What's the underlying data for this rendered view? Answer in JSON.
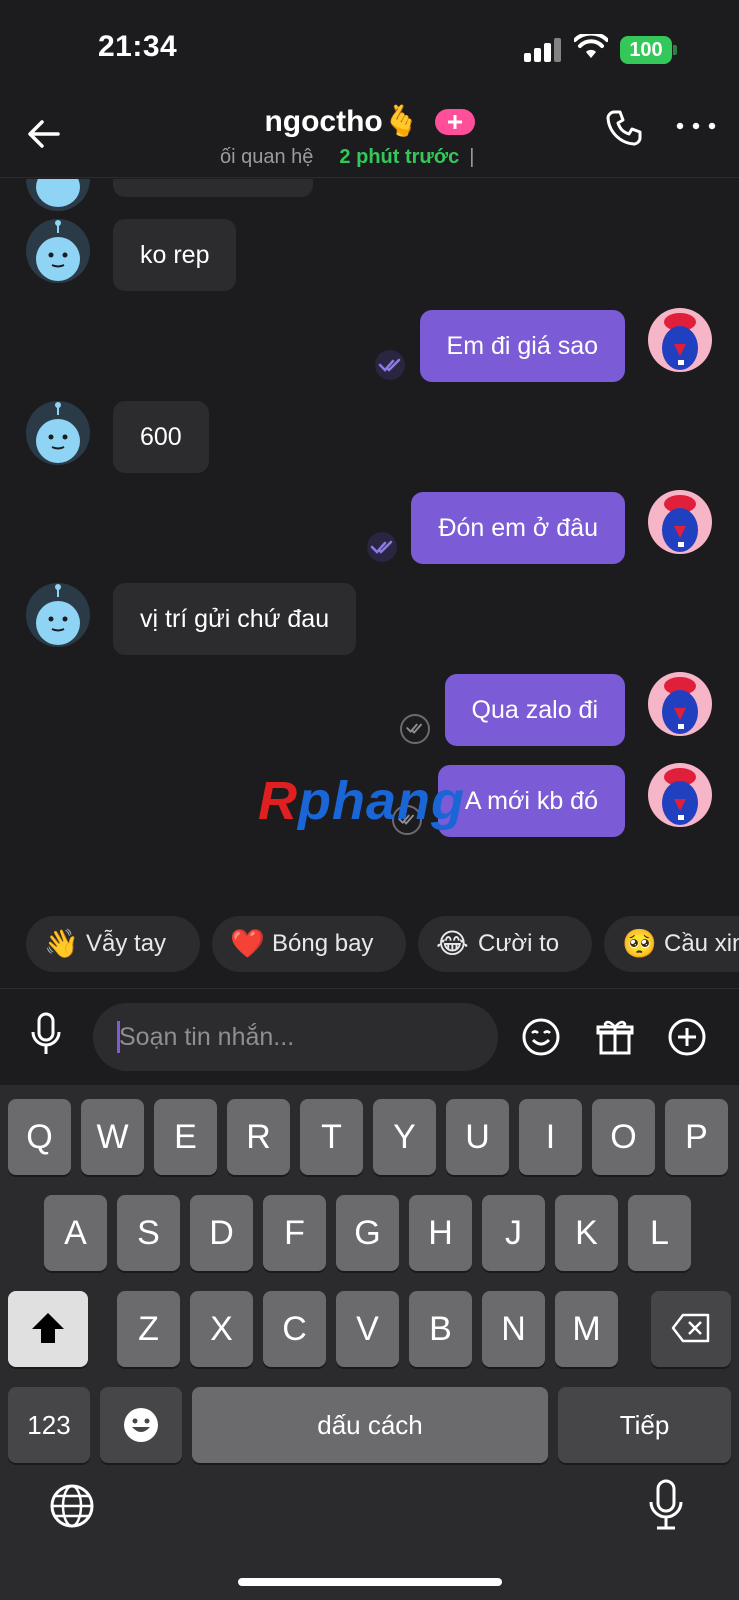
{
  "status_bar": {
    "time": "21:34",
    "battery": "100"
  },
  "header": {
    "contact_name": "ngoctho",
    "name_emoji": "🫰",
    "subtitle_relation": "ối quan hệ",
    "subtitle_last_seen": "2 phút trước",
    "subtitle_separator": "|"
  },
  "messages": {
    "m1": "ko rep",
    "m2": "Em đi giá sao",
    "m3": "600",
    "m4": "Đón em ở đâu",
    "m5": "vị trí gửi chứ đau",
    "m6": "Qua zalo đi",
    "m7": "A mới kb đó"
  },
  "watermark": {
    "first": "R",
    "rest": "phang"
  },
  "quick_reactions": [
    {
      "emoji": "👋",
      "label": "Vẫy tay"
    },
    {
      "emoji": "❤️",
      "label": "Bóng bay"
    },
    {
      "emoji": "😂",
      "label": "Cười to"
    },
    {
      "emoji": "🥺",
      "label": "Cầu xin"
    }
  ],
  "composer": {
    "placeholder": "Soạn tin nhắn..."
  },
  "keyboard": {
    "row1": [
      "Q",
      "W",
      "E",
      "R",
      "T",
      "Y",
      "U",
      "I",
      "O",
      "P"
    ],
    "row2": [
      "A",
      "S",
      "D",
      "F",
      "G",
      "H",
      "J",
      "K",
      "L"
    ],
    "row3": [
      "Z",
      "X",
      "C",
      "V",
      "B",
      "N",
      "M"
    ],
    "numbers_key": "123",
    "space_key": "dấu cách",
    "return_key": "Tiếp"
  },
  "colors": {
    "accent": "#7b5cd6",
    "online": "#34c759",
    "badge": "#ff4f9a"
  }
}
